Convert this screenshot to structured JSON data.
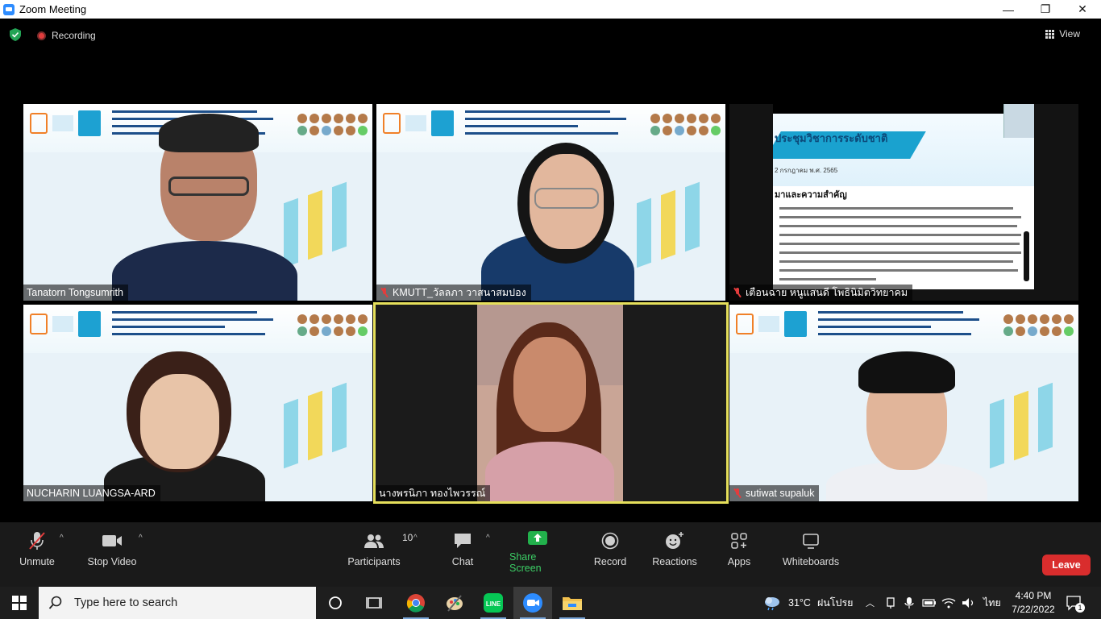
{
  "window": {
    "title": "Zoom Meeting",
    "controls": [
      "—",
      "❐",
      "✕"
    ]
  },
  "topbar": {
    "recording_label": "Recording",
    "view_label": "View"
  },
  "participants": [
    {
      "name": "Tanatorn Tongsumrith",
      "muted": false
    },
    {
      "name": "KMUTT_วัลลภา วาสนาสมปอง",
      "muted": true
    },
    {
      "name": "เตือนฉาย  หนูแสนดี  โพธินิมิตวิทยาคม",
      "muted": true
    },
    {
      "name": "NUCHARIN LUANGSA-ARD",
      "muted": false
    },
    {
      "name": "นางพรนิภา ทองไพวรรณ์",
      "muted": false,
      "active_speaker": true
    },
    {
      "name": "sutiwat supaluk",
      "muted": true
    }
  ],
  "shared_slide": {
    "heading": "ประชุมวิชาการระดับชาติ",
    "date": "2 กรกฎาคม พ.ศ. 2565",
    "section_title": "มาและความสำคัญ"
  },
  "toolbar": {
    "unmute": "Unmute",
    "stop_video": "Stop Video",
    "participants": "Participants",
    "participant_count": "10",
    "chat": "Chat",
    "share_screen": "Share Screen",
    "record": "Record",
    "reactions": "Reactions",
    "apps": "Apps",
    "whiteboards": "Whiteboards",
    "leave": "Leave"
  },
  "taskbar": {
    "search_placeholder": "Type here to search",
    "weather": "31°C",
    "weather_desc": "ฝนโปรย",
    "language": "ไทย",
    "time": "4:40 PM",
    "date": "7/22/2022",
    "notification_count": "1"
  },
  "colors": {
    "accent_green": "#22b14c",
    "leave_red": "#d92d2d",
    "active_border": "#e5df5b",
    "muted_red": "#e23d3d"
  }
}
